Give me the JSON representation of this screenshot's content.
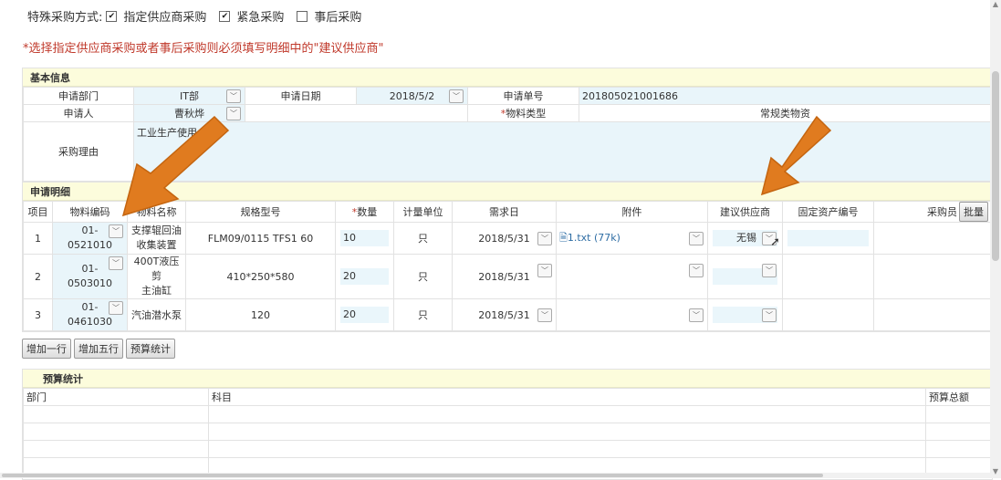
{
  "special": {
    "label": "特殊采购方式:",
    "options": [
      {
        "label": "指定供应商采购",
        "checked": true
      },
      {
        "label": "紧急采购",
        "checked": true
      },
      {
        "label": "事后采购",
        "checked": false
      }
    ]
  },
  "warning": "*选择指定供应商采购或者事后采购则必须填写明细中的\"建议供应商\"",
  "basic": {
    "title": "基本信息",
    "dept_label": "申请部门",
    "dept_value": "IT部",
    "date_label": "申请日期",
    "date_value": "2018/5/2",
    "no_label": "申请单号",
    "no_value": "201805021001686",
    "applicant_label": "申请人",
    "applicant_value": "曹秋烨",
    "type_label": "物料类型",
    "type_req": "*",
    "type_value": "常规类物资",
    "reason_label": "采购理由",
    "reason_value": "工业生产使用。"
  },
  "detail": {
    "title": "申请明细",
    "headers": [
      "项目",
      "物料编码",
      "物料名称",
      "规格型号",
      "数量",
      "计量单位",
      "需求日",
      "附件",
      "建议供应商",
      "固定资产编号",
      "采购员"
    ],
    "qty_req": "*",
    "batch_label": "批量",
    "rows": [
      {
        "idx": "1",
        "code1": "01-",
        "code2": "0521010",
        "name1": "支撑辊回油",
        "name2": "收集装置",
        "spec": "FLM09/0115 TFS1 60",
        "qty": "10",
        "unit": "只",
        "date": "2018/5/31",
        "attach": "1.txt (77k)",
        "supplier": "无锡"
      },
      {
        "idx": "2",
        "code1": "01-",
        "code2": "0503010",
        "name1": "400T液压剪",
        "name2": "主油缸",
        "spec": "410*250*580",
        "qty": "20",
        "unit": "只",
        "date": "2018/5/31",
        "attach": "",
        "supplier": ""
      },
      {
        "idx": "3",
        "code1": "01-",
        "code2": "0461030",
        "name1": "汽油潜水泵",
        "name2": "",
        "spec": "120",
        "qty": "20",
        "unit": "只",
        "date": "2018/5/31",
        "attach": "",
        "supplier": ""
      }
    ]
  },
  "buttons": {
    "add_one": "增加一行",
    "add_five": "增加五行",
    "budget": "预算统计"
  },
  "budget": {
    "title": "预算统计",
    "headers": [
      "部门",
      "科目",
      "预算总额"
    ]
  },
  "colors": {
    "accent_arrow": "#e07b1f",
    "warning": "#c0392b",
    "header_bg": "#fcfcdc",
    "input_bg": "#e9f5fa"
  }
}
